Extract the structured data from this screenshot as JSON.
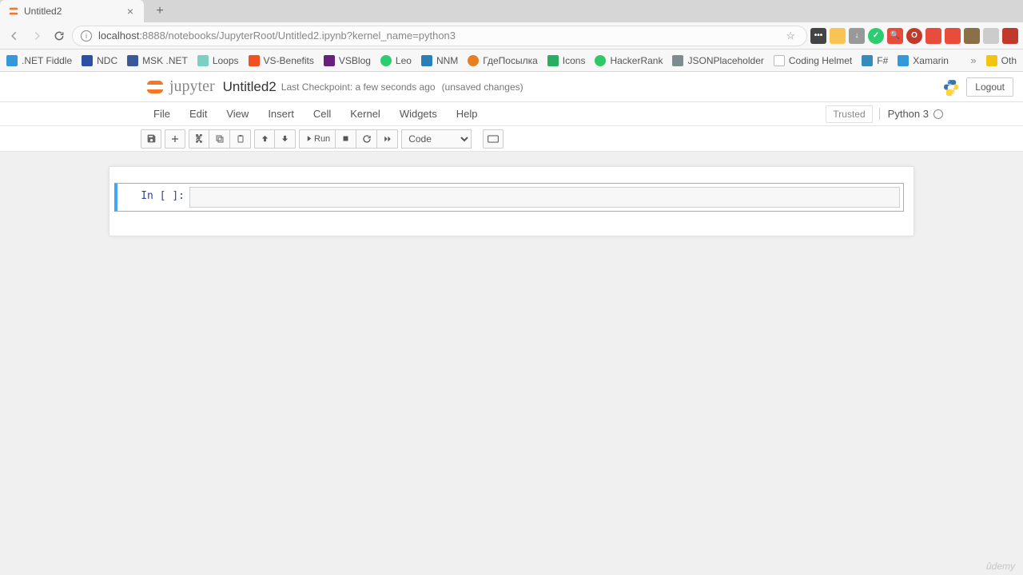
{
  "browser": {
    "tab_title": "Untitled2",
    "url_host": "localhost",
    "url_port": ":8888",
    "url_path": "/notebooks/JupyterRoot/Untitled2.ipynb?kernel_name=python3",
    "bookmarks": [
      {
        "label": ".NET Fiddle",
        "color": "#3498db"
      },
      {
        "label": "NDC",
        "color": "#2c50a4"
      },
      {
        "label": "MSK .NET",
        "color": "#3b5998"
      },
      {
        "label": "Loops",
        "color": "#7bd0c1"
      },
      {
        "label": "VS-Benefits",
        "color": "#f25022"
      },
      {
        "label": "VSBlog",
        "color": "#68217a"
      },
      {
        "label": "Leo",
        "color": "#2ecc71"
      },
      {
        "label": "NNM",
        "color": "#2980b9"
      },
      {
        "label": "ГдеПосылка",
        "color": "#e67e22"
      },
      {
        "label": "Icons",
        "color": "#27ae60"
      },
      {
        "label": "HackerRank",
        "color": "#2ec866"
      },
      {
        "label": "JSONPlaceholder",
        "color": "#7f8c8d"
      },
      {
        "label": "Coding Helmet",
        "color": "#bdc3c7"
      },
      {
        "label": "F#",
        "color": "#378bba"
      },
      {
        "label": "Xamarin",
        "color": "#3498db"
      },
      {
        "label": "Oth",
        "color": "#f1c40f"
      }
    ]
  },
  "jupyter": {
    "brand": "jupyter",
    "notebook_name": "Untitled2",
    "checkpoint": "Last Checkpoint: a few seconds ago",
    "save_status": "(unsaved changes)",
    "logout": "Logout",
    "menu": [
      "File",
      "Edit",
      "View",
      "Insert",
      "Cell",
      "Kernel",
      "Widgets",
      "Help"
    ],
    "trusted": "Trusted",
    "kernel": "Python 3",
    "toolbar": {
      "run": "Run",
      "celltype": "Code"
    },
    "cell_prompt": "In [ ]:"
  },
  "watermark": "ûdemy"
}
